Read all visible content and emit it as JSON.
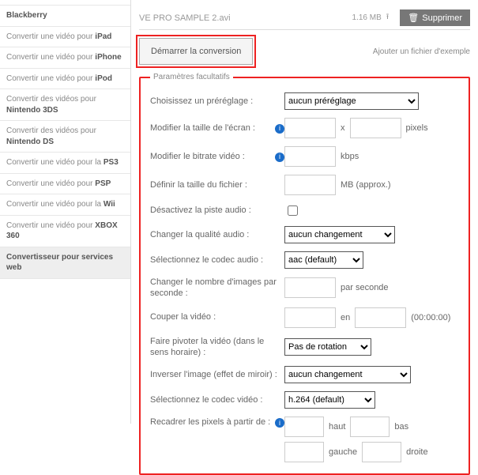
{
  "sidebar": {
    "items": [
      {
        "prefix": "",
        "bold": "Blackberry"
      },
      {
        "prefix": "Convertir une vidéo pour ",
        "bold": "iPad"
      },
      {
        "prefix": "Convertir une vidéo pour ",
        "bold": "iPhone"
      },
      {
        "prefix": "Convertir une vidéo pour ",
        "bold": "iPod"
      },
      {
        "prefix": "Convertir des vidéos pour ",
        "bold": "Nintendo 3DS"
      },
      {
        "prefix": "Convertir des vidéos pour ",
        "bold": "Nintendo DS"
      },
      {
        "prefix": "Convertir une vidéo pour la ",
        "bold": "PS3"
      },
      {
        "prefix": "Convertir une vidéo pour ",
        "bold": "PSP"
      },
      {
        "prefix": "Convertir une vidéo pour la ",
        "bold": "Wii"
      },
      {
        "prefix": "Convertir une vidéo pour ",
        "bold": "XBOX 360"
      },
      {
        "prefix": "",
        "bold": "Convertisseur pour services web"
      }
    ]
  },
  "file": {
    "name": "VE PRO SAMPLE 2.avi",
    "size": "1.16 MB"
  },
  "buttons": {
    "delete": "Supprimer",
    "start": "Démarrer la conversion",
    "add": "Ajouter un fichier d'exemple"
  },
  "legend": "Paramètres facultatifs",
  "labels": {
    "preset": "Choisissez un préréglage :",
    "screenSize": "Modifier la taille de l'écran :",
    "bitrate": "Modifier le bitrate vidéo :",
    "fileSize": "Définir la taille du fichier :",
    "disableAudio": "Désactivez la piste audio :",
    "audioQuality": "Changer la qualité audio :",
    "audioCodec": "Sélectionnez le codec audio :",
    "fps": "Changer le nombre d'images par seconde :",
    "cut": "Couper la vidéo :",
    "rotate": "Faire pivoter la vidéo (dans le sens horaire) :",
    "mirror": "Inverser l'image (effet de miroir) :",
    "videoCodec": "Sélectionnez le codec vidéo :",
    "crop": "Recadrer les pixels à partir de :"
  },
  "units": {
    "pixels": "pixels",
    "kbps": "kbps",
    "mb": "MB (approx.)",
    "perSecond": "par seconde",
    "en": "en",
    "cutHint": "(00:00:00)",
    "x": "x",
    "haut": "haut",
    "bas": "bas",
    "gauche": "gauche",
    "droite": "droite"
  },
  "selects": {
    "preset": "aucun préréglage",
    "audioQuality": "aucun changement",
    "audioCodec": "aac (default)",
    "rotate": "Pas de rotation",
    "mirror": "aucun changement",
    "videoCodec": "h.264 (default)"
  },
  "info": "i"
}
